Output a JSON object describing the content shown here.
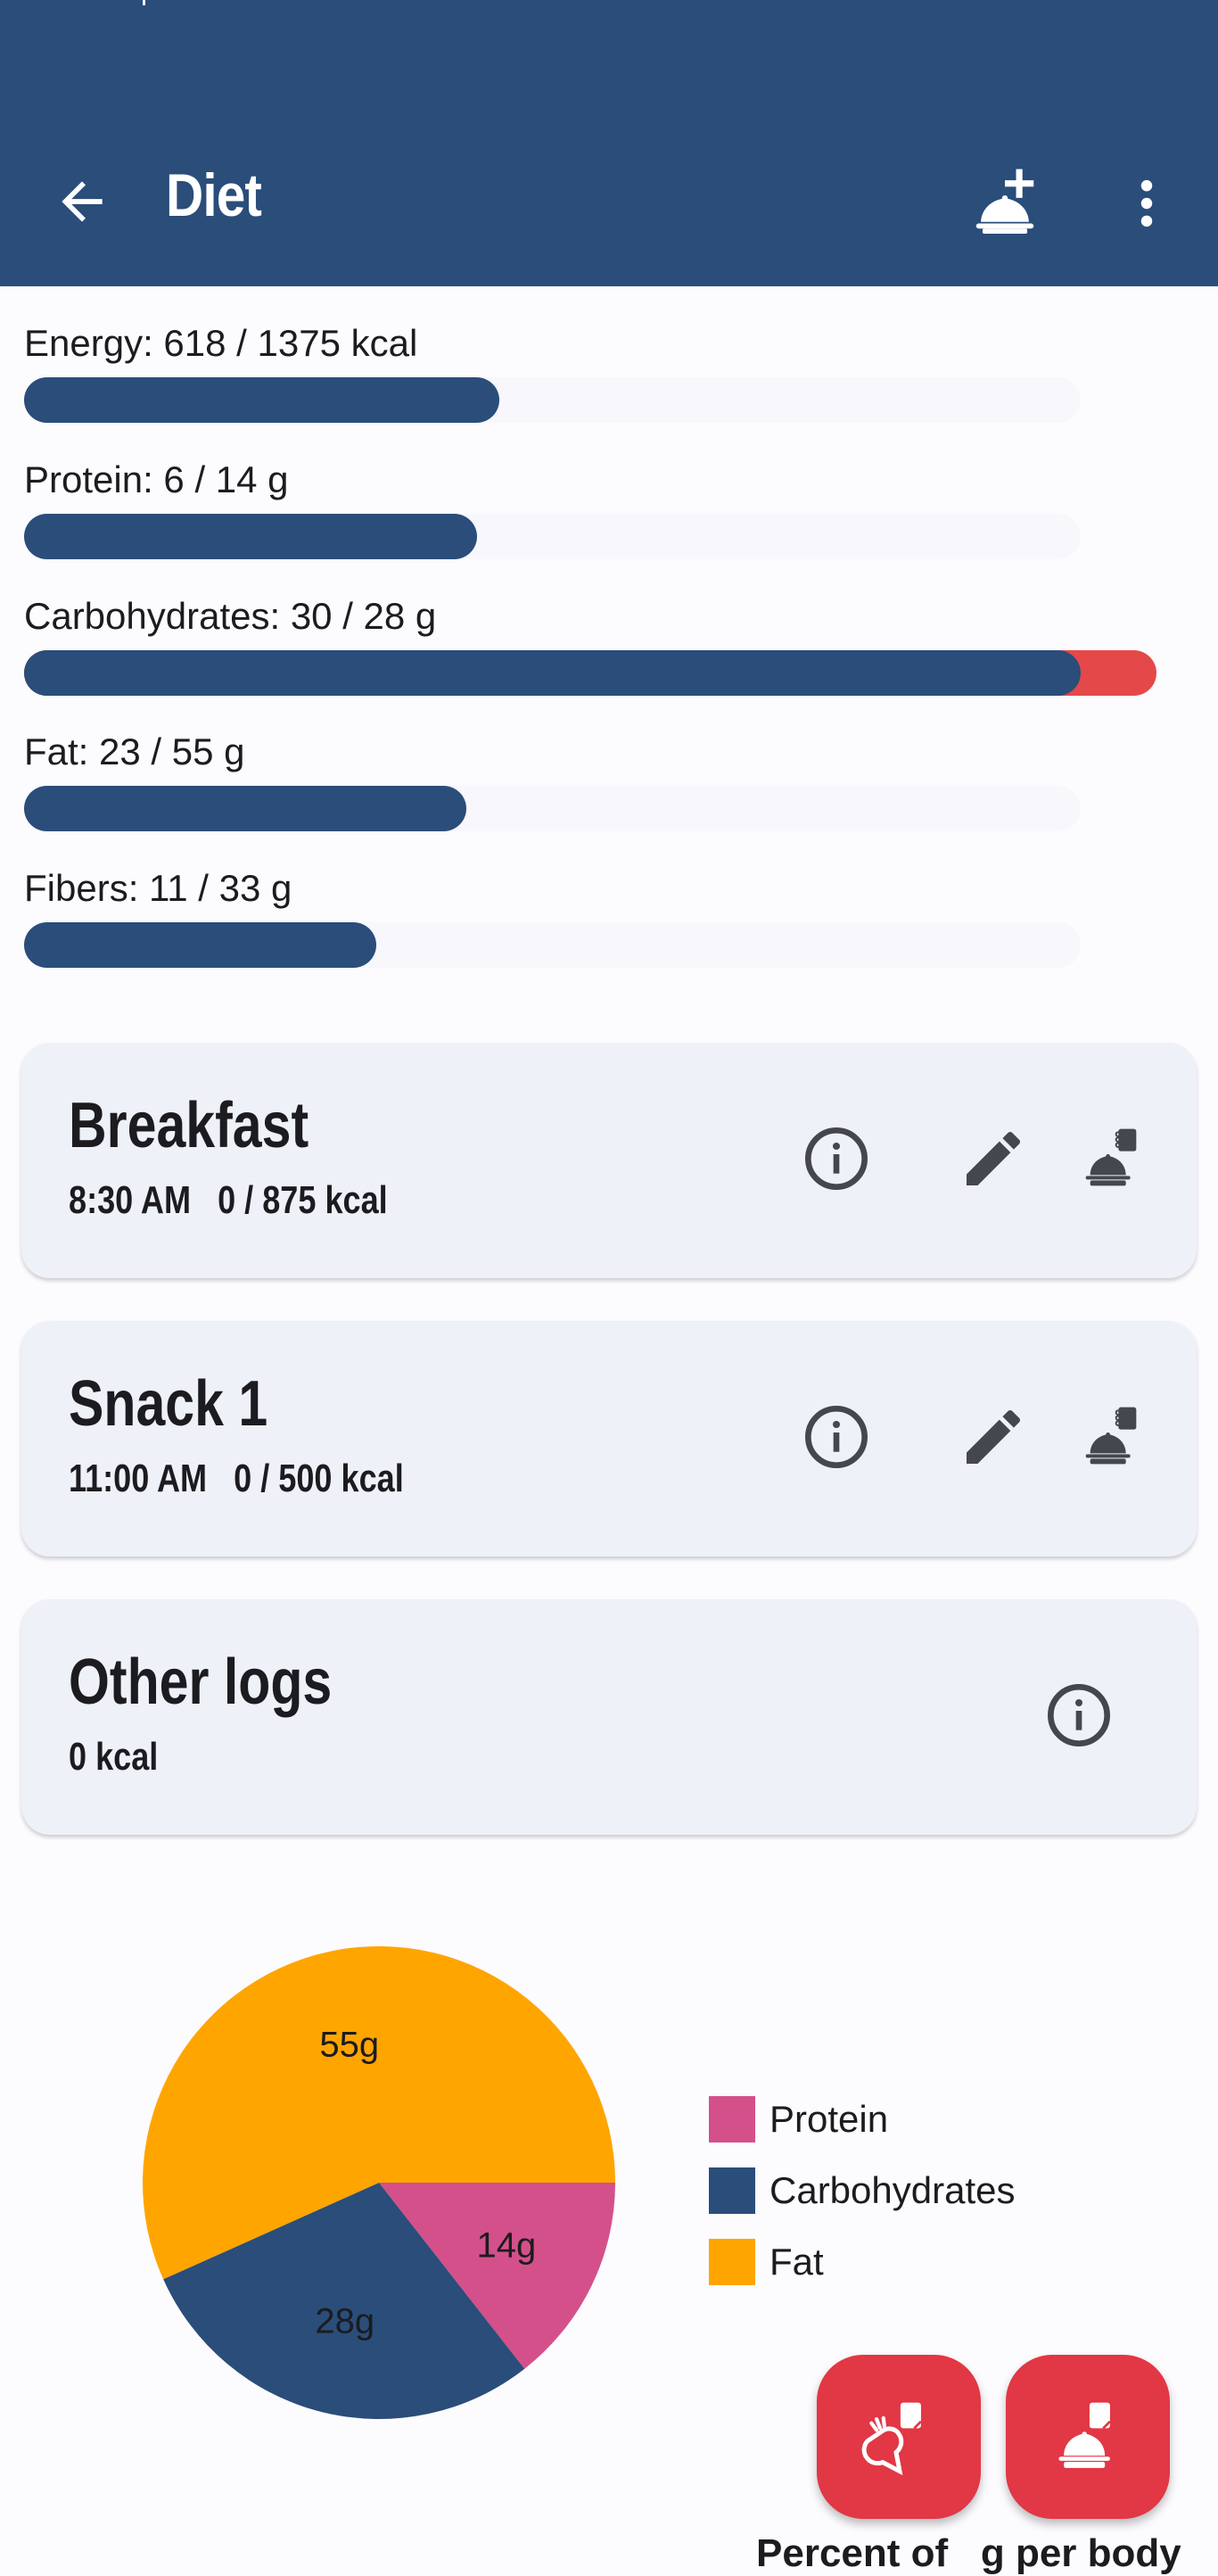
{
  "appbar": {
    "title": "Diet",
    "back_icon": "arrow-back-icon",
    "add_meal_icon": "meal-add-icon",
    "more_icon": "more-vert-icon",
    "color": "#2a4d7a"
  },
  "nutrients": [
    {
      "label": "Energy: 618 / 1375 kcal",
      "value": 618,
      "goal": 1375,
      "unit": "kcal"
    },
    {
      "label": "Protein: 6 / 14 g",
      "value": 6,
      "goal": 14,
      "unit": "g"
    },
    {
      "label": "Carbohydrates: 30 / 28 g",
      "value": 30,
      "goal": 28,
      "unit": "g",
      "over_goal": true
    },
    {
      "label": "Fat: 23 / 55 g",
      "value": 23,
      "goal": 55,
      "unit": "g"
    },
    {
      "label": "Fibers: 11 / 33 g",
      "value": 11,
      "goal": 33,
      "unit": "g"
    }
  ],
  "colors": {
    "primary": "#2a4d7a",
    "over": "#e54848",
    "fab": "#e23744",
    "protein": "#d4508a",
    "carbohydrates": "#2a4d7a",
    "fat": "#ffa500"
  },
  "meals": [
    {
      "title": "Breakfast",
      "subtitle": "8:30 AM   0 / 875 kcal",
      "time": "8:30 AM",
      "kcal": "0 / 875 kcal",
      "icons": [
        "info-icon",
        "edit-icon",
        "meal-log-icon"
      ]
    },
    {
      "title": "Snack 1",
      "subtitle": "11:00 AM   0 / 500 kcal",
      "time": "11:00 AM",
      "kcal": "0 / 500 kcal",
      "icons": [
        "info-icon",
        "edit-icon",
        "meal-log-icon"
      ]
    },
    {
      "title": "Other logs",
      "subtitle": "0 kcal",
      "kcal": "0 kcal",
      "icons": [
        "info-icon"
      ]
    }
  ],
  "chart_data": {
    "type": "pie",
    "title": "",
    "categories": [
      "Protein",
      "Carbohydrates",
      "Fat"
    ],
    "values": [
      14,
      28,
      55
    ],
    "labels": [
      "14g",
      "28g",
      "55g"
    ],
    "unit": "g",
    "colors": [
      "#d4508a",
      "#2a4d7a",
      "#ffa500"
    ],
    "legend": "right"
  },
  "fabs": [
    {
      "name": "log-ingredient",
      "icon": "carrot-notebook-icon"
    },
    {
      "name": "log-meal",
      "icon": "meal-notebook-icon"
    }
  ],
  "bottom_text": "Percent of   g per body"
}
